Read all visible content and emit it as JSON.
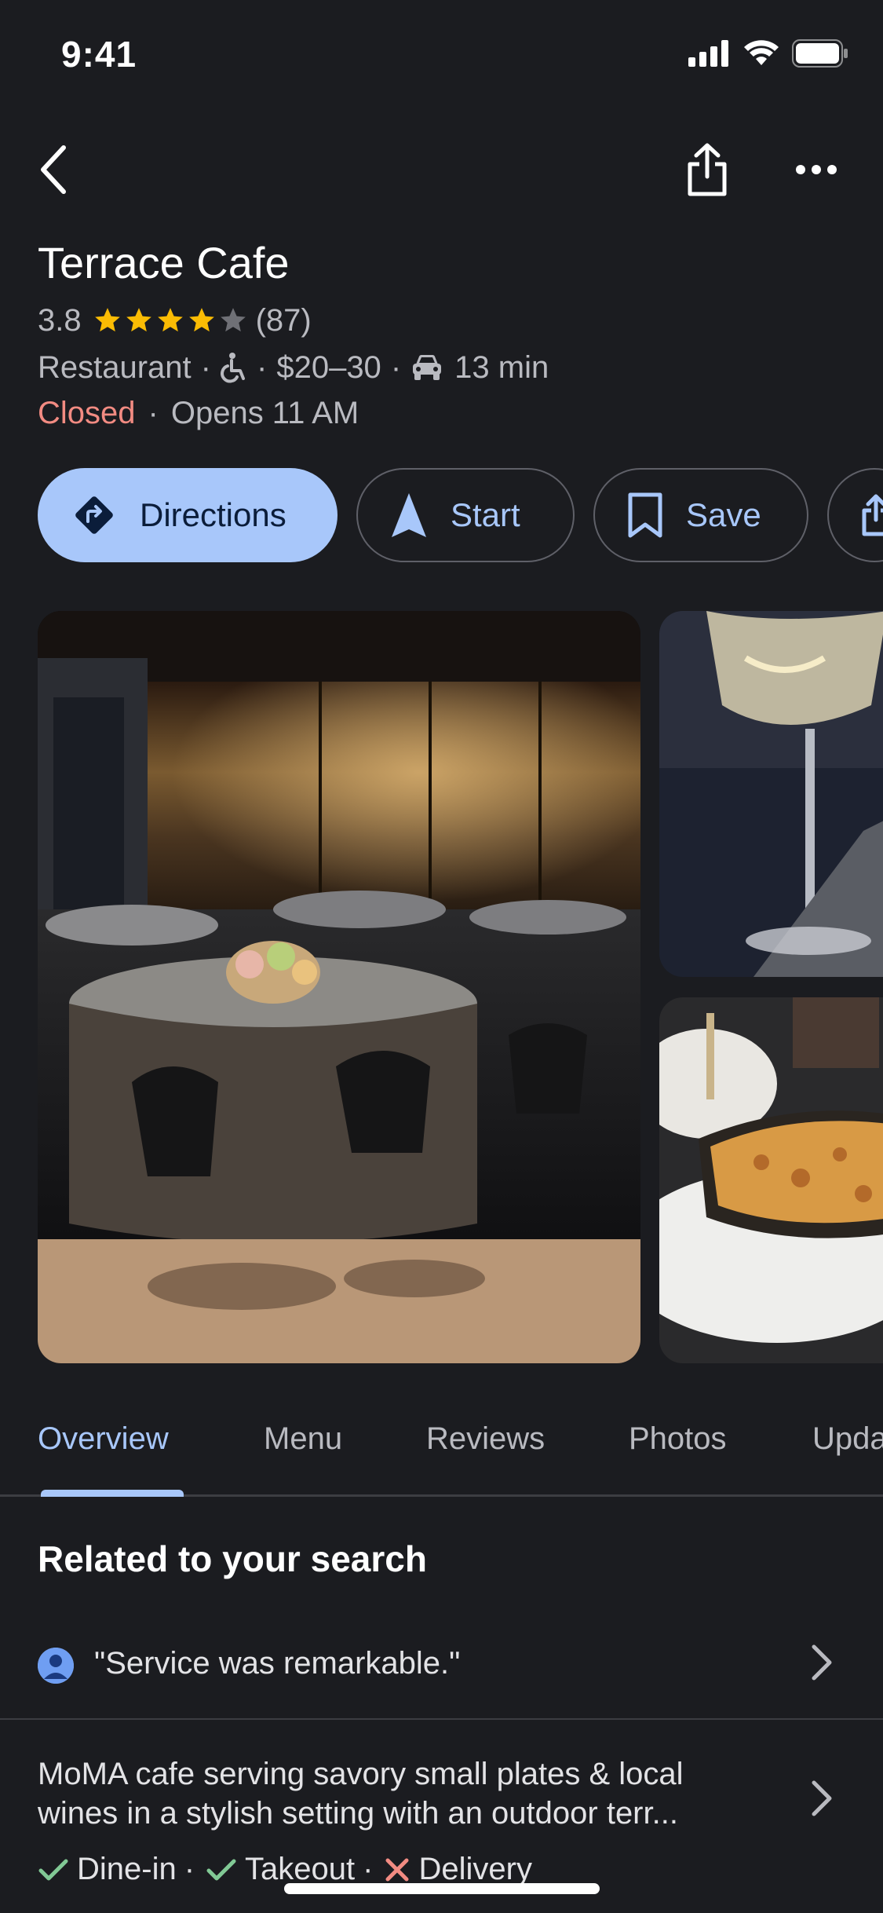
{
  "status_bar": {
    "time": "9:41"
  },
  "place": {
    "name": "Terrace Cafe",
    "rating": "3.8",
    "stars_filled": 4,
    "stars_total": 5,
    "review_count": "(87)",
    "category": "Restaurant",
    "price": "$20–30",
    "drive_time": "13 min",
    "status": "Closed",
    "hours_note": "Opens 11 AM"
  },
  "actions": {
    "directions_label": "Directions",
    "start_label": "Start",
    "save_label": "Save"
  },
  "tabs": [
    {
      "label": "Overview"
    },
    {
      "label": "Menu"
    },
    {
      "label": "Reviews"
    },
    {
      "label": "Photos"
    },
    {
      "label": "Upda"
    }
  ],
  "related": {
    "title": "Related to your search",
    "review_snippet": "\"Service was remarkable.\"",
    "description": "MoMA cafe serving savory small plates & local wines in a stylish setting with an outdoor terr...",
    "amenities": [
      {
        "label": "Dine-in",
        "available": true
      },
      {
        "label": "Takeout",
        "available": true
      },
      {
        "label": "Delivery",
        "available": false
      }
    ]
  },
  "colors": {
    "background": "#1b1c20",
    "accent": "#a8c7fa",
    "closed": "#f28b82",
    "star": "#fbbc04",
    "check": "#81c995",
    "cross": "#f28b82"
  }
}
